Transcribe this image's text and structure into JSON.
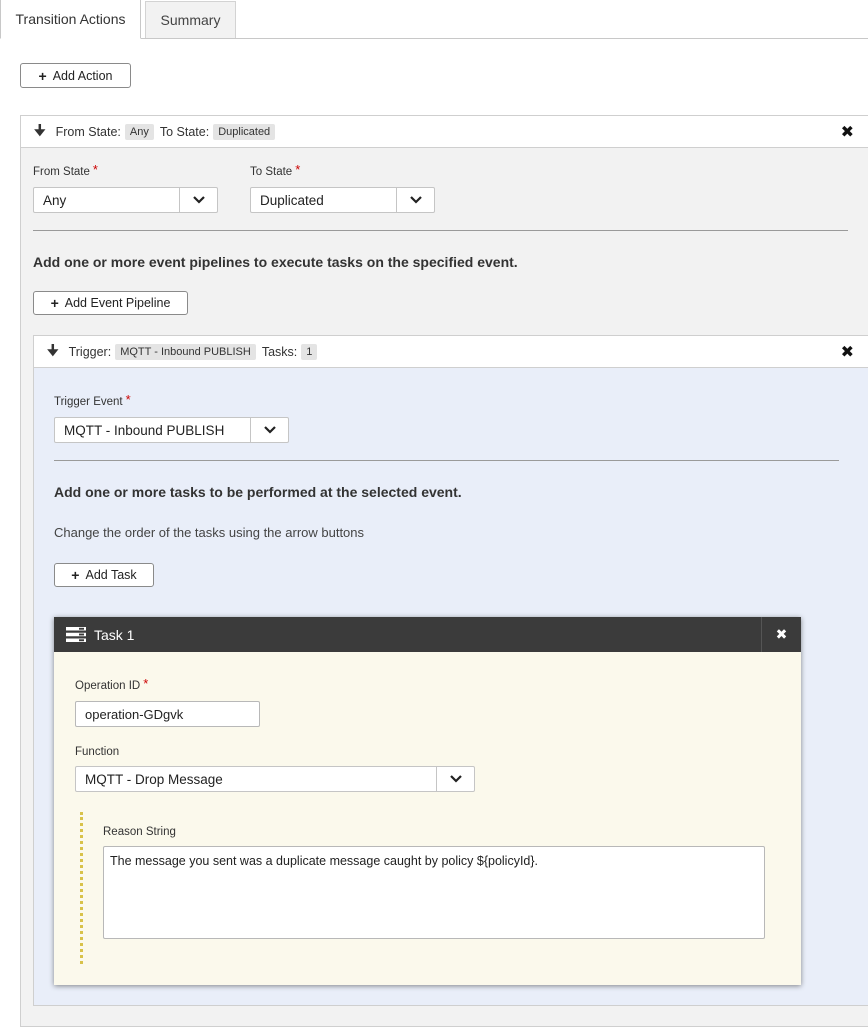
{
  "tabs": [
    {
      "label": "Transition Actions",
      "active": true
    },
    {
      "label": "Summary",
      "active": false
    }
  ],
  "add_action_label": "Add Action",
  "transition": {
    "header": {
      "from_label": "From State:",
      "from_value": "Any",
      "to_label": "To State:",
      "to_value": "Duplicated"
    },
    "from_state_label": "From State",
    "from_state_value": "Any",
    "to_state_label": "To State",
    "to_state_value": "Duplicated",
    "required_mark": "*",
    "pipelines_heading": "Add one or more event pipelines to execute tasks on the specified event.",
    "add_pipeline_label": "Add Event Pipeline"
  },
  "pipeline": {
    "header": {
      "trigger_label": "Trigger:",
      "trigger_value": "MQTT - Inbound PUBLISH",
      "tasks_label": "Tasks:",
      "tasks_count": "1"
    },
    "trigger_event_label": "Trigger Event",
    "trigger_event_value": "MQTT - Inbound PUBLISH",
    "tasks_heading": "Add one or more tasks to be performed at the selected event.",
    "tasks_hint": "Change the order of the tasks using the arrow buttons",
    "add_task_label": "Add Task"
  },
  "task": {
    "title": "Task 1",
    "operation_id_label": "Operation ID",
    "operation_id_value": "operation-GDgvk",
    "function_label": "Function",
    "function_value": "MQTT - Drop Message",
    "reason_label": "Reason String",
    "reason_value": "The message you sent was a duplicate message caught by policy ${policyId}."
  },
  "icons": {
    "plus": "+",
    "collapse": "chevron-down-arrow",
    "close": "close-x",
    "task": "task-list-icon"
  }
}
